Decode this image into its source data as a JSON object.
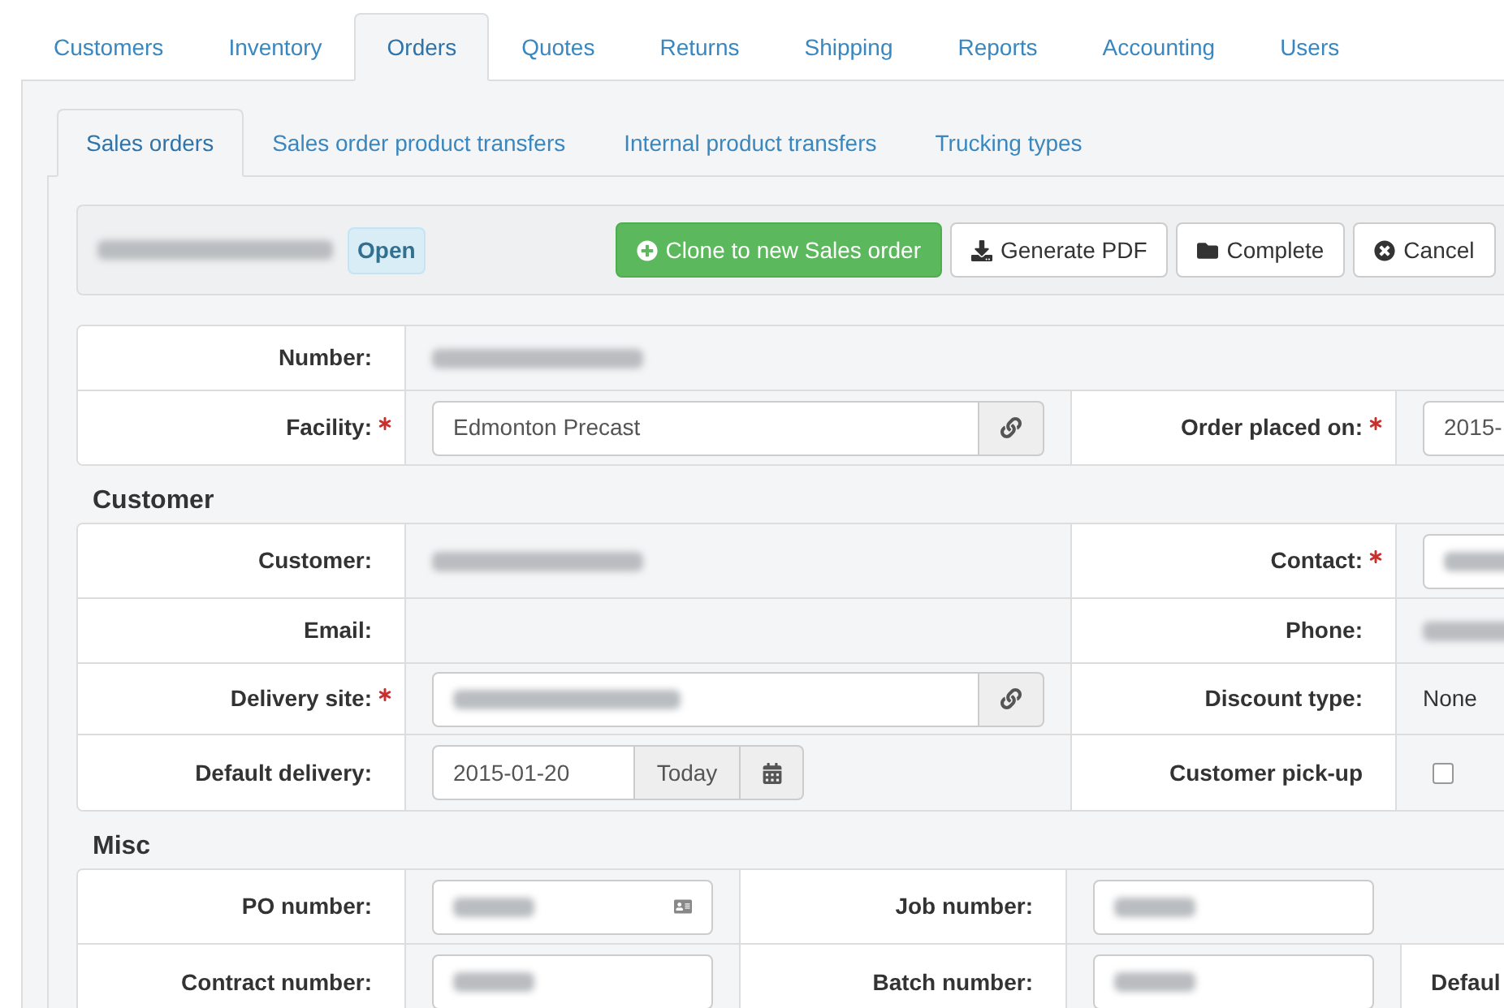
{
  "main_tabs": [
    {
      "label": "Customers",
      "selected": false
    },
    {
      "label": "Inventory",
      "selected": false
    },
    {
      "label": "Orders",
      "selected": true
    },
    {
      "label": "Quotes",
      "selected": false
    },
    {
      "label": "Returns",
      "selected": false
    },
    {
      "label": "Shipping",
      "selected": false
    },
    {
      "label": "Reports",
      "selected": false
    },
    {
      "label": "Accounting",
      "selected": false
    },
    {
      "label": "Users",
      "selected": false
    }
  ],
  "sub_tabs": [
    {
      "label": "Sales orders",
      "selected": true
    },
    {
      "label": "Sales order product transfers",
      "selected": false
    },
    {
      "label": "Internal product transfers",
      "selected": false
    },
    {
      "label": "Trucking types",
      "selected": false
    }
  ],
  "toolbar": {
    "status_badge": "Open",
    "buttons": [
      {
        "label": "Clone to new Sales order",
        "kind": "primary"
      },
      {
        "label": "Generate PDF",
        "kind": "default"
      },
      {
        "label": "Complete",
        "kind": "default"
      },
      {
        "label": "Cancel",
        "kind": "default"
      }
    ]
  },
  "sections": [
    {
      "rows": [
        {
          "cells": [
            {
              "kind": "label",
              "text": "Number:",
              "required": false
            },
            {
              "kind": "redacted"
            },
            {
              "kind": "empty"
            },
            {
              "kind": "empty"
            }
          ]
        },
        {
          "cells": [
            {
              "kind": "label",
              "text": "Facility:",
              "required": true
            },
            {
              "kind": "link_input",
              "value": "Edmonton Precast"
            },
            {
              "kind": "label",
              "text": "Order placed on:",
              "required": true
            },
            {
              "kind": "input",
              "value": "2015-"
            }
          ]
        }
      ]
    },
    {
      "heading": "Customer",
      "rows": [
        {
          "cells": [
            {
              "kind": "label",
              "text": "Customer:",
              "required": false
            },
            {
              "kind": "redacted"
            },
            {
              "kind": "label",
              "text": "Contact:",
              "required": true
            },
            {
              "kind": "redacted_input"
            }
          ]
        },
        {
          "cells": [
            {
              "kind": "label",
              "text": "Email:",
              "required": false
            },
            {
              "kind": "empty"
            },
            {
              "kind": "label",
              "text": "Phone:",
              "required": false
            },
            {
              "kind": "redacted"
            }
          ]
        },
        {
          "cells": [
            {
              "kind": "label",
              "text": "Delivery site:",
              "required": true
            },
            {
              "kind": "redacted_link_input"
            },
            {
              "kind": "label",
              "text": "Discount type:",
              "required": false
            },
            {
              "kind": "text",
              "text": "None"
            }
          ]
        },
        {
          "cells": [
            {
              "kind": "label",
              "text": "Default delivery:",
              "required": false
            },
            {
              "kind": "date_input",
              "value": "2015-01-20",
              "button": "Today"
            },
            {
              "kind": "label",
              "text": "Customer pick-up",
              "required": false
            },
            {
              "kind": "checkbox",
              "checked": false
            }
          ]
        }
      ]
    },
    {
      "heading": "Misc",
      "rows": [
        {
          "cells": [
            {
              "kind": "label",
              "text": "PO number:",
              "required": false
            },
            {
              "kind": "redacted_card_input"
            },
            {
              "kind": "label",
              "text": "Job number:",
              "required": false
            },
            {
              "kind": "redacted_input"
            },
            {
              "kind": "empty"
            }
          ]
        },
        {
          "cells": [
            {
              "kind": "label",
              "text": "Contract number:",
              "required": false
            },
            {
              "kind": "redacted_input"
            },
            {
              "kind": "label",
              "text": "Batch number:",
              "required": false
            },
            {
              "kind": "redacted_input"
            },
            {
              "kind": "label",
              "text": "Defaul"
            }
          ]
        }
      ]
    }
  ]
}
